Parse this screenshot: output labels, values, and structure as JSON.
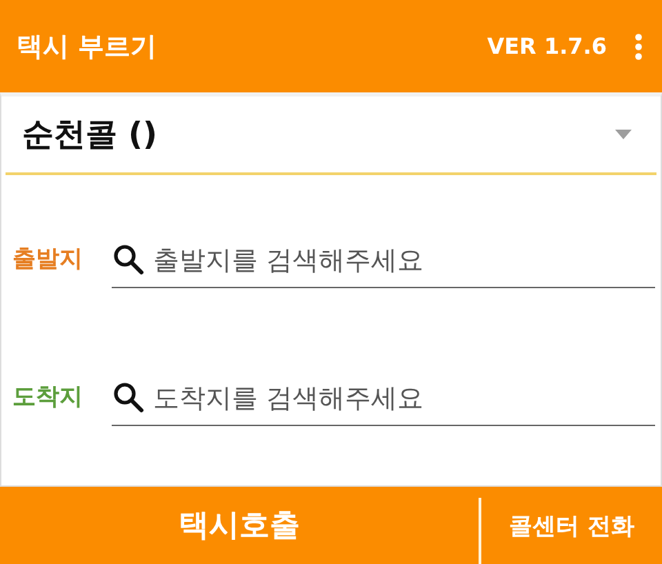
{
  "app_bar": {
    "title": "택시 부르기",
    "version": "VER 1.7.6"
  },
  "company_select": {
    "value": "순천콜 ()"
  },
  "locations": [
    {
      "label": "출발지",
      "color": "#e67e22",
      "placeholder": "출발지를 검색해주세요"
    },
    {
      "label": "도착지",
      "color": "#5c9e3c",
      "placeholder": "도착지를 검색해주세요"
    }
  ],
  "bottom_bar": {
    "primary": "택시호출",
    "secondary": "콜센터 전화"
  }
}
